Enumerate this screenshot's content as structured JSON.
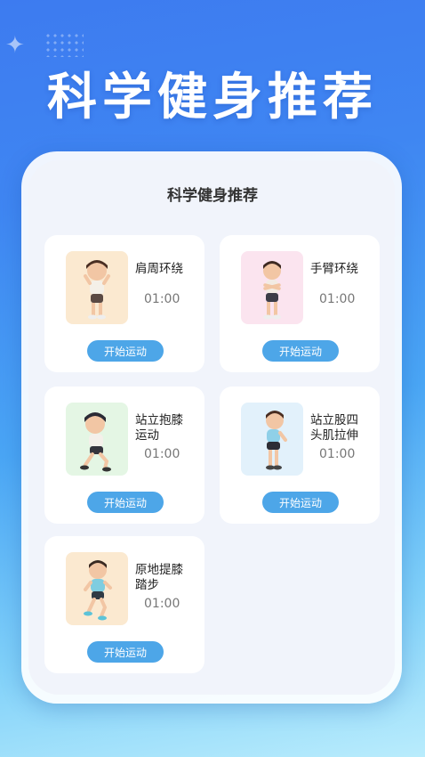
{
  "hero": {
    "title": "科学健身推荐"
  },
  "panel": {
    "title": "科学健身推荐"
  },
  "exercises": [
    {
      "name": "肩周环绕",
      "duration": "01:00",
      "button": "开始运动",
      "thumb_bg": "#fbe9d0",
      "shirt": "#f4f0e8",
      "pants": "#5b4a44",
      "icon": "figure-hands-on-shoulders-icon"
    },
    {
      "name": "手臂环绕",
      "duration": "01:00",
      "button": "开始运动",
      "thumb_bg": "#fbe4ef",
      "shirt": "#f2ece4",
      "pants": "#3d3d48",
      "icon": "figure-arms-crossed-icon"
    },
    {
      "name": "站立抱膝运动",
      "duration": "01:00",
      "button": "开始运动",
      "thumb_bg": "#e4f6e4",
      "shirt": "#f4f0ea",
      "pants": "#34343c",
      "icon": "figure-knee-hug-icon"
    },
    {
      "name": "站立股四头肌拉伸",
      "duration": "01:00",
      "button": "开始运动",
      "thumb_bg": "#e2f1fb",
      "shirt": "#8fd0e8",
      "pants": "#2d2d35",
      "icon": "figure-quad-stretch-icon"
    },
    {
      "name": "原地提膝踏步",
      "duration": "01:00",
      "button": "开始运动",
      "thumb_bg": "#fbe9d0",
      "shirt": "#7fcde0",
      "pants": "#2f3a44",
      "icon": "figure-marching-icon"
    }
  ],
  "colors": {
    "accent": "#4da6e8",
    "background_top": "#3d7bf0",
    "background_bottom": "#b9ecfc"
  }
}
